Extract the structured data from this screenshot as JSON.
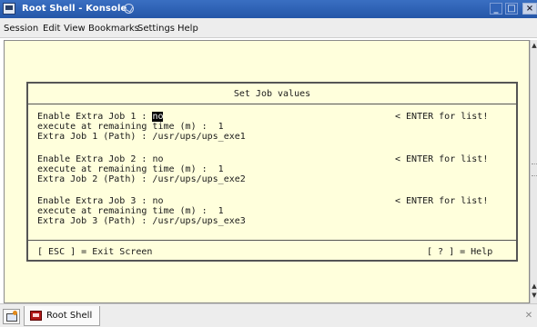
{
  "window": {
    "title": "Root Shell - Konsole",
    "icon": "konsole-icon",
    "buttons": {
      "minimize": "_",
      "maximize": "□",
      "close": "×"
    }
  },
  "menu": [
    "Session",
    "Edit",
    "View",
    "Bookmarks",
    "Settings",
    "Help"
  ],
  "dialog": {
    "title": "Set Job values",
    "jobs": [
      {
        "enable_label": "Enable Extra Job 1 : ",
        "enable_value": "no",
        "hint": "< ENTER for list!",
        "execute_line": "execute at remaining time (m) :  1",
        "path_line": "Extra Job 1 (Path) : /usr/ups/ups_exe1"
      },
      {
        "enable_label": "Enable Extra Job 2 : ",
        "enable_value": "no",
        "hint": "< ENTER for list!",
        "execute_line": "execute at remaining time (m) :  1",
        "path_line": "Extra Job 2 (Path) : /usr/ups/ups_exe2"
      },
      {
        "enable_label": "Enable Extra Job 3 : ",
        "enable_value": "no",
        "hint": "< ENTER for list!",
        "execute_line": "execute at remaining time (m) :  1",
        "path_line": "Extra Job 3 (Path) : /usr/ups/ups_exe3"
      }
    ],
    "footer_left": "[ ESC ] = Exit Screen",
    "footer_right": "[ ? ] = Help"
  },
  "tabs": [
    {
      "label": "Root Shell",
      "icon": "terminal-icon"
    }
  ],
  "colors": {
    "terminal_background": "#ffffdc",
    "titlebar": "#2f63b6",
    "highlight": "#000000"
  }
}
